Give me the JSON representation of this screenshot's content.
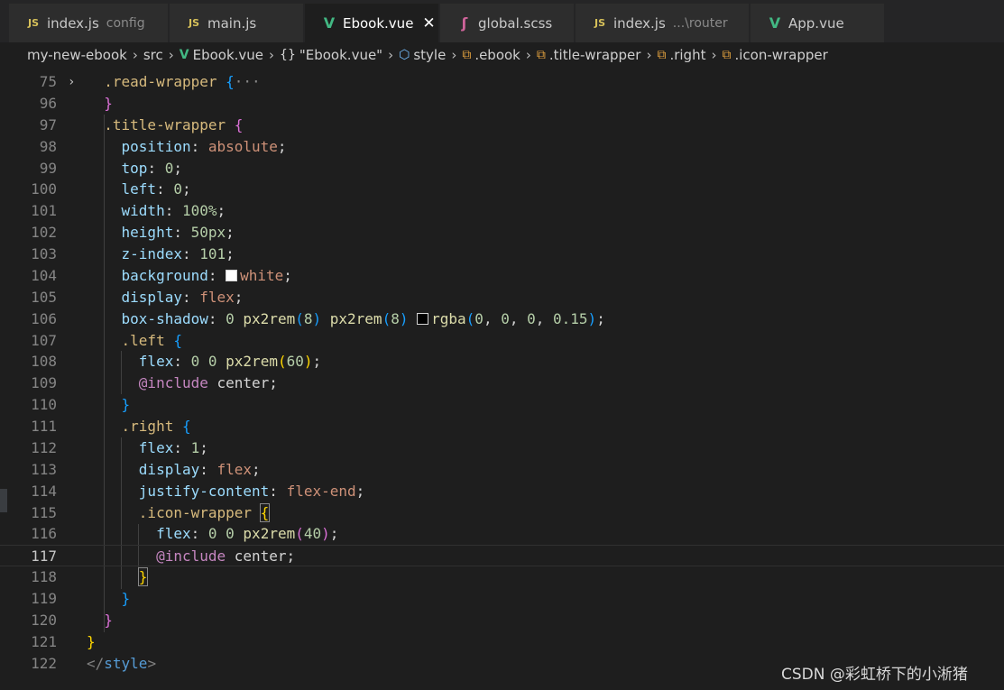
{
  "tabs": [
    {
      "icon": "js",
      "label": "index.js",
      "sub": "config",
      "active": false
    },
    {
      "icon": "js",
      "label": "main.js",
      "sub": "",
      "active": false
    },
    {
      "icon": "vue",
      "label": "Ebook.vue",
      "sub": "",
      "active": true,
      "close": "✕"
    },
    {
      "icon": "scss",
      "label": "global.scss",
      "sub": "",
      "active": false
    },
    {
      "icon": "js",
      "label": "index.js",
      "sub": "...\\router",
      "active": false
    },
    {
      "icon": "vue",
      "label": "App.vue",
      "sub": "",
      "active": false
    }
  ],
  "breadcrumbs": [
    {
      "icon": "",
      "label": "my-new-ebook"
    },
    {
      "icon": "",
      "label": "src"
    },
    {
      "icon": "vue-icon",
      "label": "Ebook.vue"
    },
    {
      "icon": "braces-icon",
      "label": "\"Ebook.vue\""
    },
    {
      "icon": "cube-icon",
      "label": "style"
    },
    {
      "icon": "selector-icon",
      "label": ".ebook"
    },
    {
      "icon": "selector-icon",
      "label": ".title-wrapper"
    },
    {
      "icon": "selector-icon",
      "label": ".right"
    },
    {
      "icon": "selector-icon",
      "label": ".icon-wrapper"
    }
  ],
  "current_line": "117",
  "lines": [
    {
      "n": "75",
      "fold": "›",
      "tokens": [
        {
          "t": "  ",
          "c": "plain"
        },
        {
          "t": ".read-wrapper",
          "c": "sel"
        },
        {
          "t": " ",
          "c": "plain"
        },
        {
          "t": "{",
          "c": "p2"
        },
        {
          "t": "···",
          "c": "dots"
        }
      ]
    },
    {
      "n": "96",
      "tokens": [
        {
          "t": "  ",
          "c": "plain"
        },
        {
          "t": "}",
          "c": "p1"
        }
      ]
    },
    {
      "n": "97",
      "tokens": [
        {
          "t": "  ",
          "c": "plain"
        },
        {
          "t": ".title-wrapper",
          "c": "sel"
        },
        {
          "t": " ",
          "c": "plain"
        },
        {
          "t": "{",
          "c": "p1"
        }
      ]
    },
    {
      "n": "98",
      "tokens": [
        {
          "t": "    ",
          "c": "plain"
        },
        {
          "t": "position",
          "c": "prop"
        },
        {
          "t": ": ",
          "c": "plain"
        },
        {
          "t": "absolute",
          "c": "val"
        },
        {
          "t": ";",
          "c": "plain"
        }
      ]
    },
    {
      "n": "99",
      "tokens": [
        {
          "t": "    ",
          "c": "plain"
        },
        {
          "t": "top",
          "c": "prop"
        },
        {
          "t": ": ",
          "c": "plain"
        },
        {
          "t": "0",
          "c": "num"
        },
        {
          "t": ";",
          "c": "plain"
        }
      ]
    },
    {
      "n": "100",
      "tokens": [
        {
          "t": "    ",
          "c": "plain"
        },
        {
          "t": "left",
          "c": "prop"
        },
        {
          "t": ": ",
          "c": "plain"
        },
        {
          "t": "0",
          "c": "num"
        },
        {
          "t": ";",
          "c": "plain"
        }
      ]
    },
    {
      "n": "101",
      "tokens": [
        {
          "t": "    ",
          "c": "plain"
        },
        {
          "t": "width",
          "c": "prop"
        },
        {
          "t": ": ",
          "c": "plain"
        },
        {
          "t": "100%",
          "c": "num"
        },
        {
          "t": ";",
          "c": "plain"
        }
      ]
    },
    {
      "n": "102",
      "tokens": [
        {
          "t": "    ",
          "c": "plain"
        },
        {
          "t": "height",
          "c": "prop"
        },
        {
          "t": ": ",
          "c": "plain"
        },
        {
          "t": "50px",
          "c": "num"
        },
        {
          "t": ";",
          "c": "plain"
        }
      ]
    },
    {
      "n": "103",
      "tokens": [
        {
          "t": "    ",
          "c": "plain"
        },
        {
          "t": "z-index",
          "c": "prop"
        },
        {
          "t": ": ",
          "c": "plain"
        },
        {
          "t": "101",
          "c": "num"
        },
        {
          "t": ";",
          "c": "plain"
        }
      ]
    },
    {
      "n": "104",
      "tokens": [
        {
          "t": "    ",
          "c": "plain"
        },
        {
          "t": "background",
          "c": "prop"
        },
        {
          "t": ": ",
          "c": "plain"
        },
        {
          "swatch": "#ffffff"
        },
        {
          "t": "white",
          "c": "val"
        },
        {
          "t": ";",
          "c": "plain"
        }
      ]
    },
    {
      "n": "105",
      "tokens": [
        {
          "t": "    ",
          "c": "plain"
        },
        {
          "t": "display",
          "c": "prop"
        },
        {
          "t": ": ",
          "c": "plain"
        },
        {
          "t": "flex",
          "c": "val"
        },
        {
          "t": ";",
          "c": "plain"
        }
      ]
    },
    {
      "n": "106",
      "tokens": [
        {
          "t": "    ",
          "c": "plain"
        },
        {
          "t": "box-shadow",
          "c": "prop"
        },
        {
          "t": ": ",
          "c": "plain"
        },
        {
          "t": "0",
          "c": "num"
        },
        {
          "t": " ",
          "c": "plain"
        },
        {
          "t": "px2rem",
          "c": "fn"
        },
        {
          "t": "(",
          "c": "p2"
        },
        {
          "t": "8",
          "c": "num"
        },
        {
          "t": ")",
          "c": "p2"
        },
        {
          "t": " ",
          "c": "plain"
        },
        {
          "t": "px2rem",
          "c": "fn"
        },
        {
          "t": "(",
          "c": "p2"
        },
        {
          "t": "8",
          "c": "num"
        },
        {
          "t": ")",
          "c": "p2"
        },
        {
          "t": " ",
          "c": "plain"
        },
        {
          "swatch": "#000000"
        },
        {
          "t": "rgba",
          "c": "fn"
        },
        {
          "t": "(",
          "c": "p2"
        },
        {
          "t": "0",
          "c": "num"
        },
        {
          "t": ", ",
          "c": "plain"
        },
        {
          "t": "0",
          "c": "num"
        },
        {
          "t": ", ",
          "c": "plain"
        },
        {
          "t": "0",
          "c": "num"
        },
        {
          "t": ", ",
          "c": "plain"
        },
        {
          "t": "0.15",
          "c": "num"
        },
        {
          "t": ")",
          "c": "p2"
        },
        {
          "t": ";",
          "c": "plain"
        }
      ]
    },
    {
      "n": "107",
      "tokens": [
        {
          "t": "    ",
          "c": "plain"
        },
        {
          "t": ".left",
          "c": "sel"
        },
        {
          "t": " ",
          "c": "plain"
        },
        {
          "t": "{",
          "c": "p2"
        }
      ]
    },
    {
      "n": "108",
      "tokens": [
        {
          "t": "      ",
          "c": "plain"
        },
        {
          "t": "flex",
          "c": "prop"
        },
        {
          "t": ": ",
          "c": "plain"
        },
        {
          "t": "0",
          "c": "num"
        },
        {
          "t": " ",
          "c": "plain"
        },
        {
          "t": "0",
          "c": "num"
        },
        {
          "t": " ",
          "c": "plain"
        },
        {
          "t": "px2rem",
          "c": "fn"
        },
        {
          "t": "(",
          "c": "p3"
        },
        {
          "t": "60",
          "c": "num"
        },
        {
          "t": ")",
          "c": "p3"
        },
        {
          "t": ";",
          "c": "plain"
        }
      ]
    },
    {
      "n": "109",
      "tokens": [
        {
          "t": "      ",
          "c": "plain"
        },
        {
          "t": "@include",
          "c": "at"
        },
        {
          "t": " center;",
          "c": "plain"
        }
      ]
    },
    {
      "n": "110",
      "tokens": [
        {
          "t": "    ",
          "c": "plain"
        },
        {
          "t": "}",
          "c": "p2"
        }
      ]
    },
    {
      "n": "111",
      "tokens": [
        {
          "t": "    ",
          "c": "plain"
        },
        {
          "t": ".right",
          "c": "sel"
        },
        {
          "t": " ",
          "c": "plain"
        },
        {
          "t": "{",
          "c": "p2"
        }
      ]
    },
    {
      "n": "112",
      "tokens": [
        {
          "t": "      ",
          "c": "plain"
        },
        {
          "t": "flex",
          "c": "prop"
        },
        {
          "t": ": ",
          "c": "plain"
        },
        {
          "t": "1",
          "c": "num"
        },
        {
          "t": ";",
          "c": "plain"
        }
      ]
    },
    {
      "n": "113",
      "tokens": [
        {
          "t": "      ",
          "c": "plain"
        },
        {
          "t": "display",
          "c": "prop"
        },
        {
          "t": ": ",
          "c": "plain"
        },
        {
          "t": "flex",
          "c": "val"
        },
        {
          "t": ";",
          "c": "plain"
        }
      ]
    },
    {
      "n": "114",
      "tokens": [
        {
          "t": "      ",
          "c": "plain"
        },
        {
          "t": "justify-content",
          "c": "prop"
        },
        {
          "t": ": ",
          "c": "plain"
        },
        {
          "t": "flex-end",
          "c": "val"
        },
        {
          "t": ";",
          "c": "plain"
        }
      ]
    },
    {
      "n": "115",
      "tokens": [
        {
          "t": "      ",
          "c": "plain"
        },
        {
          "t": ".icon-wrapper",
          "c": "sel"
        },
        {
          "t": " ",
          "c": "plain"
        },
        {
          "t": "{",
          "c": "p3",
          "match": true
        }
      ]
    },
    {
      "n": "116",
      "tokens": [
        {
          "t": "        ",
          "c": "plain"
        },
        {
          "t": "flex",
          "c": "prop"
        },
        {
          "t": ": ",
          "c": "plain"
        },
        {
          "t": "0",
          "c": "num"
        },
        {
          "t": " ",
          "c": "plain"
        },
        {
          "t": "0",
          "c": "num"
        },
        {
          "t": " ",
          "c": "plain"
        },
        {
          "t": "px2rem",
          "c": "fn"
        },
        {
          "t": "(",
          "c": "p1"
        },
        {
          "t": "40",
          "c": "num"
        },
        {
          "t": ")",
          "c": "p1"
        },
        {
          "t": ";",
          "c": "plain"
        }
      ]
    },
    {
      "n": "117",
      "tokens": [
        {
          "t": "        ",
          "c": "plain"
        },
        {
          "t": "@include",
          "c": "at"
        },
        {
          "t": " center;",
          "c": "plain"
        }
      ]
    },
    {
      "n": "118",
      "tokens": [
        {
          "t": "      ",
          "c": "plain"
        },
        {
          "t": "}",
          "c": "p3",
          "match": true
        }
      ]
    },
    {
      "n": "119",
      "tokens": [
        {
          "t": "    ",
          "c": "plain"
        },
        {
          "t": "}",
          "c": "p2"
        }
      ]
    },
    {
      "n": "120",
      "tokens": [
        {
          "t": "  ",
          "c": "plain"
        },
        {
          "t": "}",
          "c": "p1"
        }
      ]
    },
    {
      "n": "121",
      "tokens": [
        {
          "t": "}",
          "c": "p3"
        }
      ]
    },
    {
      "n": "122",
      "tokens": [
        {
          "t": "</",
          "c": "ang"
        },
        {
          "t": "style",
          "c": "tag"
        },
        {
          "t": ">",
          "c": "ang"
        }
      ]
    }
  ],
  "watermark": "CSDN @彩虹桥下的小淅猪"
}
